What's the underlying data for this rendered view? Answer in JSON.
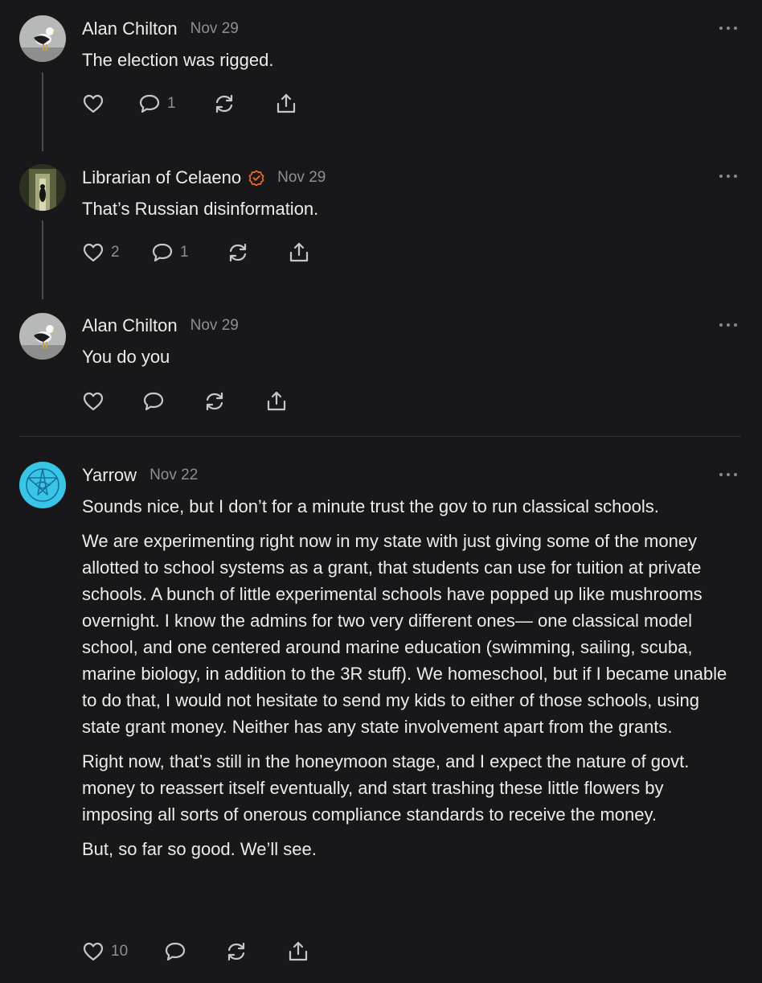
{
  "comments": [
    {
      "author": "Alan Chilton",
      "date": "Nov 29",
      "avatar": "seagull-avatar",
      "paragraphs": [
        "The election was rigged."
      ],
      "likes": "",
      "replies": "1"
    },
    {
      "author": "Librarian of Celaeno",
      "date": "Nov 29",
      "avatar": "dark-hallway-avatar",
      "verified_badge_color": "#e8682a",
      "paragraphs": [
        "That’s Russian disinformation."
      ],
      "likes": "2",
      "replies": "1"
    },
    {
      "author": "Alan Chilton",
      "date": "Nov 29",
      "avatar": "seagull-avatar",
      "paragraphs": [
        "You do you"
      ],
      "likes": "",
      "replies": ""
    },
    {
      "author": "Yarrow",
      "date": "Nov 22",
      "avatar": "blue-sigil-avatar",
      "paragraphs": [
        "Sounds nice, but I don’t for a minute trust the gov to run classical schools.",
        "We are experimenting right now in my state with just giving some of the money allotted to school systems as a grant, that students can use for tuition at private schools. A bunch of little experimental schools have popped up like mushrooms overnight. I know the admins for two very different ones— one classical model school, and one centered around marine education (swimming, sailing, scuba, marine biology, in addition to the 3R stuff). We homeschool, but if I became unable to do that, I would not hesitate to send my kids to either of those schools, using state grant money. Neither has any state involvement apart from the grants.",
        "Right now, that’s still in the honeymoon stage, and I expect the nature of govt. money to reassert itself eventually, and start trashing these little flowers by imposing all sorts of onerous compliance standards to receive the money.",
        "But, so far so good. We’ll see."
      ],
      "likes": "10",
      "replies": ""
    }
  ],
  "icons": {
    "like": "heart-icon",
    "reply": "speech-bubble-icon",
    "restack": "refresh-arrows-icon",
    "share": "share-upload-icon",
    "more": "more-dots-icon"
  },
  "colors": {
    "background": "#18181a",
    "text": "#ececec",
    "muted": "#8f8f93",
    "badge": "#e8682a",
    "yarrow_avatar": "#38c6e8"
  }
}
